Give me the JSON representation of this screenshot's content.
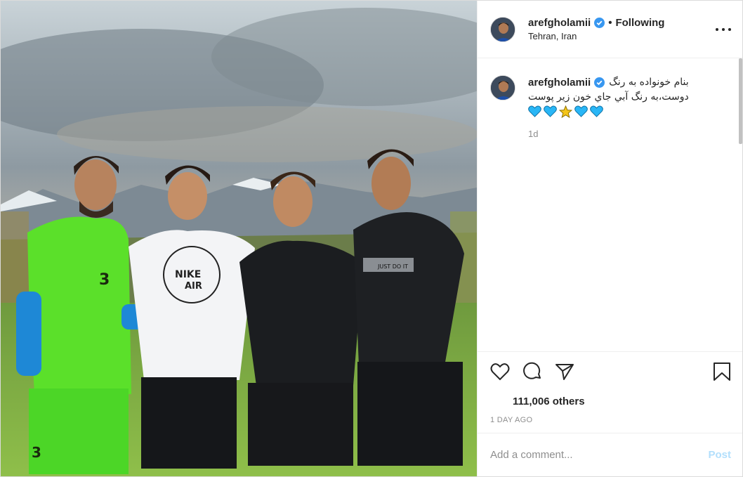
{
  "photo": {
    "alt": "Four men standing on a grass field in front of mountains"
  },
  "header": {
    "username": "arefgholamii",
    "separator": "•",
    "following": "Following",
    "location": "Tehran, Iran"
  },
  "caption": {
    "username": "arefgholamii",
    "text_line1": "بنام خونواده به رنگ",
    "text_line2": "دوست،به رنگ آبي جاي خون زير پوست",
    "time": "1d"
  },
  "likes": {
    "text": "111,006 others"
  },
  "date": "1 DAY AGO",
  "comment": {
    "placeholder": "Add a comment...",
    "post_label": "Post"
  },
  "colors": {
    "verified": "#3897f0",
    "post_disabled": "#b2dffc",
    "heart_blue": "#29b6f6",
    "star": "#f5c518"
  },
  "icons": [
    "verified-icon",
    "more-icon",
    "heart-icon",
    "comment-icon",
    "share-icon",
    "bookmark-icon",
    "blue-heart-icon",
    "star-icon"
  ]
}
